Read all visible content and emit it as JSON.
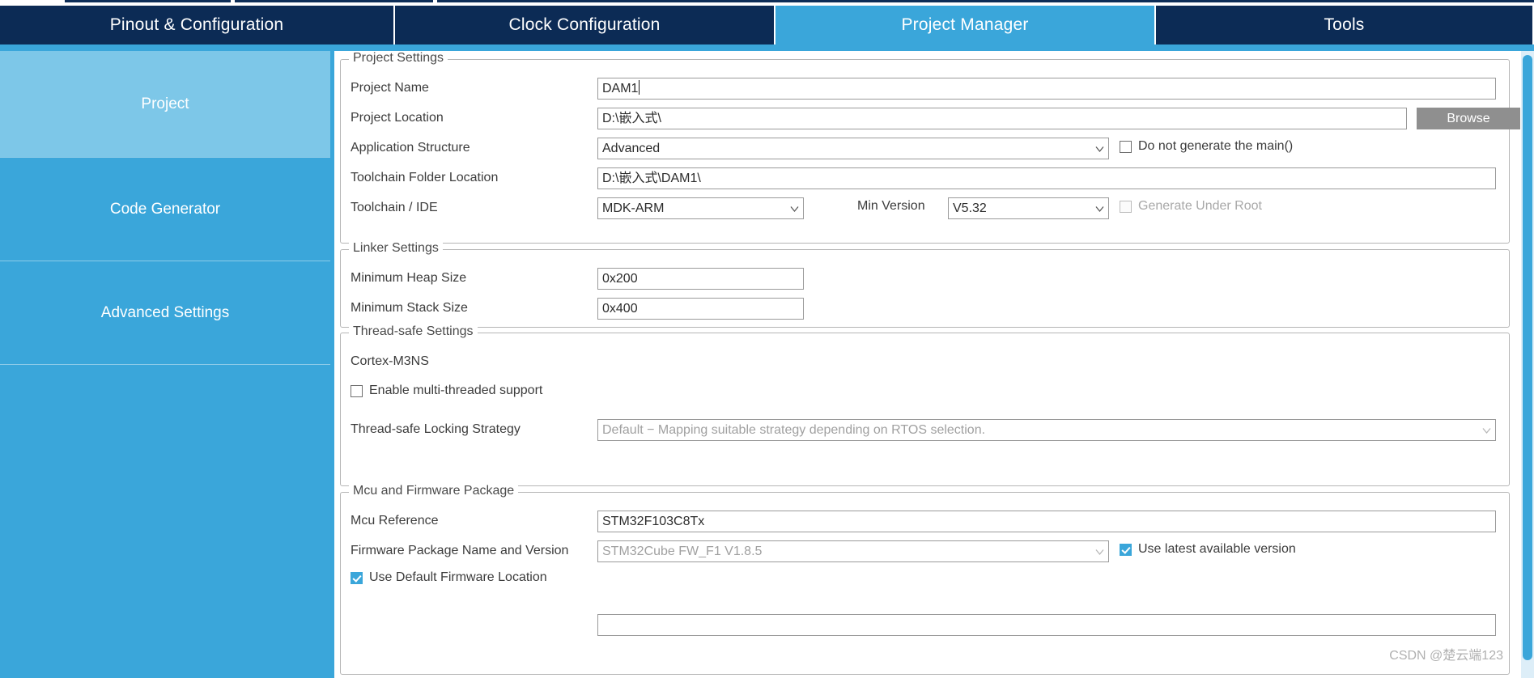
{
  "app": {
    "tabs": [
      {
        "label": "Pinout & Configuration",
        "active": false
      },
      {
        "label": "Clock Configuration",
        "active": false
      },
      {
        "label": "Project Manager",
        "active": true
      },
      {
        "label": "Tools",
        "active": false
      }
    ]
  },
  "sidebar": {
    "items": [
      {
        "label": "Project",
        "selected": true
      },
      {
        "label": "Code Generator",
        "selected": false
      },
      {
        "label": "Advanced Settings",
        "selected": false
      }
    ]
  },
  "project_settings": {
    "title": "Project Settings",
    "project_name": {
      "label": "Project Name",
      "value": "DAM1"
    },
    "project_location": {
      "label": "Project Location",
      "value": "D:\\嵌入式\\"
    },
    "browse_button": "Browse",
    "application_structure": {
      "label": "Application Structure",
      "value": "Advanced"
    },
    "do_not_generate_main": {
      "label": "Do not generate the main()",
      "checked": false
    },
    "toolchain_folder_location": {
      "label": "Toolchain Folder Location",
      "value": "D:\\嵌入式\\DAM1\\"
    },
    "toolchain_ide": {
      "label": "Toolchain / IDE",
      "value": "MDK-ARM"
    },
    "min_version": {
      "label": "Min Version",
      "value": "V5.32"
    },
    "generate_under_root": {
      "label": "Generate Under Root",
      "checked": false,
      "disabled": true
    }
  },
  "linker_settings": {
    "title": "Linker Settings",
    "minimum_heap_size": {
      "label": "Minimum Heap Size",
      "value": "0x200"
    },
    "minimum_stack_size": {
      "label": "Minimum Stack Size",
      "value": "0x400"
    }
  },
  "thread_safe_settings": {
    "title": "Thread-safe Settings",
    "core": "Cortex-M3NS",
    "enable_multi_threaded": {
      "label": "Enable multi-threaded support",
      "checked": false
    },
    "locking_strategy": {
      "label": "Thread-safe Locking Strategy",
      "value": "Default  −  Mapping suitable strategy depending on RTOS selection.",
      "disabled": true
    }
  },
  "mcu_firmware_package": {
    "title": "Mcu and Firmware Package",
    "mcu_reference": {
      "label": "Mcu Reference",
      "value": "STM32F103C8Tx"
    },
    "firmware_package": {
      "label": "Firmware Package Name and Version",
      "value": "STM32Cube FW_F1 V1.8.5",
      "disabled": true
    },
    "use_latest_available_version": {
      "label": "Use latest available version",
      "checked": true
    },
    "use_default_firmware_location": {
      "label": "Use Default Firmware Location",
      "checked": true
    }
  },
  "watermark": "CSDN @楚云端123",
  "colors": {
    "tab_inactive_bg": "#0c2b55",
    "tab_active_bg": "#3aa6da",
    "sidebar_bg": "#3aa6da",
    "sidebar_selected_bg": "#7dc7e8",
    "accent": "#3aa6da",
    "button_bg": "#8f8f8f",
    "checkbox_checked": "#3aa6da"
  }
}
